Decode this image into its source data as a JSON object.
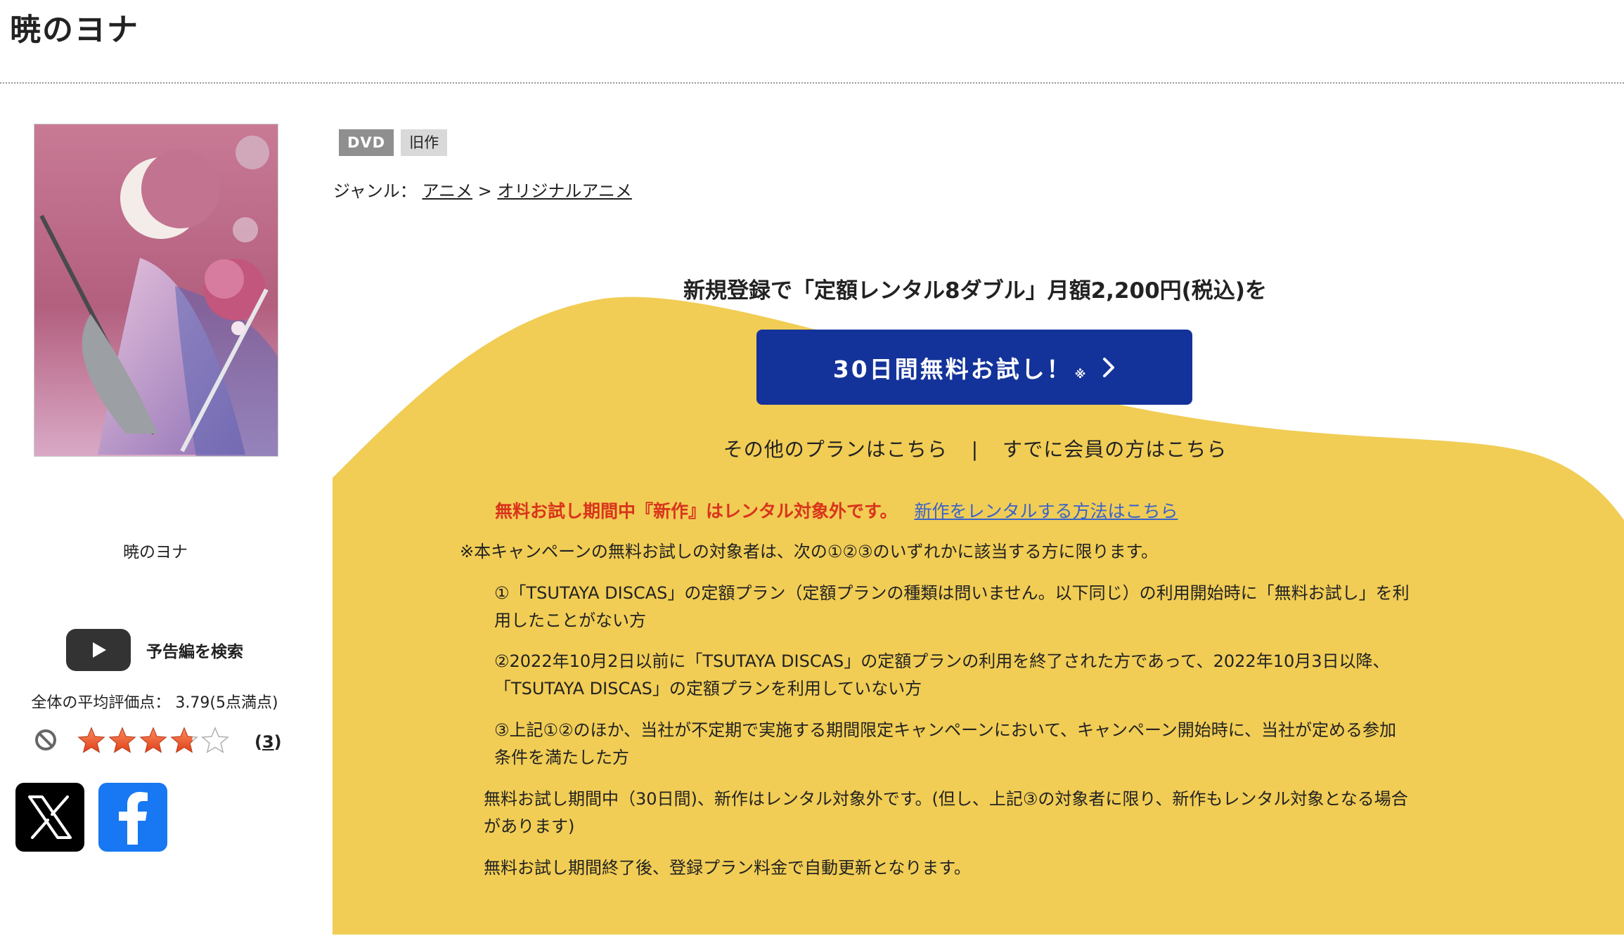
{
  "page_title": "暁のヨナ",
  "cover_title": "暁のヨナ",
  "trailer_label": "予告編を検索",
  "rating": {
    "avg_label": "全体の平均評価点：",
    "avg_value": "3.79(5点満点)",
    "value": 3.79,
    "max": 5,
    "count_open": "(",
    "count": "3",
    "count_close": ")"
  },
  "badges": {
    "dvd": "DVD",
    "old": "旧作"
  },
  "genre": {
    "label": "ジャンル：",
    "cat1": "アニメ",
    "sep": ">",
    "cat2": "オリジナルアニメ"
  },
  "promo": {
    "lead": "新規登録で「定額レンタル8ダブル」月額2,200円(税込)を",
    "cta_label": "30日間無料お試し！",
    "cta_note": "※",
    "other_plans": "その他のプランはこちら",
    "separator": "|",
    "members": "すでに会員の方はこちら",
    "warning": "無料お試し期間中『新作』はレンタル対象外です。",
    "warning_link": "新作をレンタルする方法はこちら",
    "eligibility": "※本キャンペーンの無料お試しの対象者は、次の①②③のいずれかに該当する方に限ります。",
    "cond1": [
      "①「TSUTAYA DISCAS」の定額プラン（定額プランの種類は問いません。以下同じ）の利用開始時に「無料お試し」を利",
      "用したことがない方"
    ],
    "cond2": [
      "②2022年10月2日以前に「TSUTAYA DISCAS」の定額プランの利用を終了された方であって、2022年10月3日以降、",
      "「TSUTAYA DISCAS」の定額プランを利用していない方"
    ],
    "cond3": [
      "③上記①②のほか、当社が不定期で実施する期間限定キャンペーンにおいて、キャンペーン開始時に、当社が定める参加",
      "条件を満たした方"
    ],
    "note1": [
      "無料お試し期間中（30日間)、新作はレンタル対象外です。(但し、上記③の対象者に限り、新作もレンタル対象となる場合",
      "があります)"
    ],
    "note2": "無料お試し期間終了後、登録プラン料金で自動更新となります。"
  },
  "colors": {
    "promo_yellow": "#f1cd55",
    "cta_blue": "#14339a",
    "warning_red": "#d9341c",
    "link_blue": "#3a63c9",
    "star_orange": "#f0582b"
  },
  "icons": {
    "trailer": "play-icon",
    "no_rating": "no-entry-icon",
    "share_x": "x-logo-icon",
    "share_facebook": "facebook-logo-icon"
  }
}
